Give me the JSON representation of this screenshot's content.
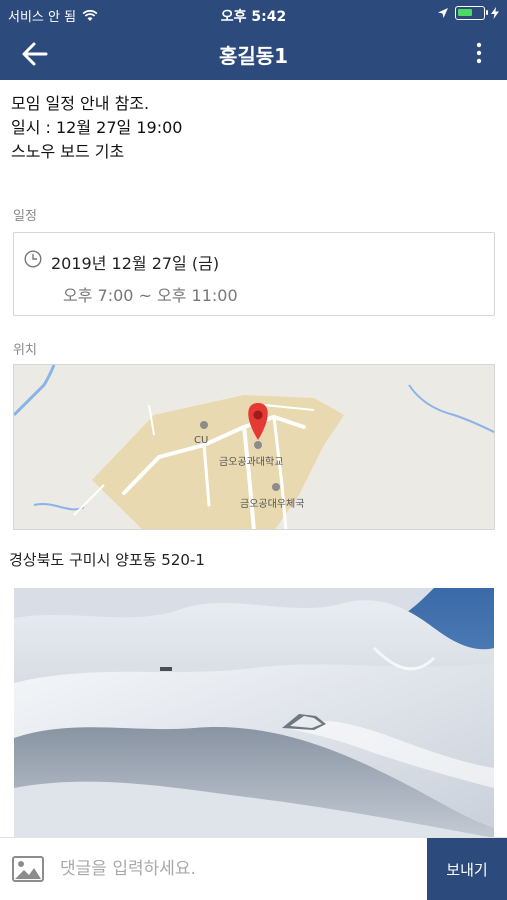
{
  "status_bar": {
    "carrier": "서비스 안 됨",
    "time": "오후 5:42",
    "battery_level": 0.6
  },
  "header": {
    "title": "홍길동1",
    "back_icon": "arrow-left-icon",
    "more_icon": "more-vertical-icon"
  },
  "post": {
    "lines": [
      "모임 일정 안내 참조.",
      "일시 : 12월 27일 19:00",
      "스노우 보드 기초"
    ]
  },
  "schedule": {
    "label": "일정",
    "date": "2019년 12월 27일 (금)",
    "time_range": "오후 7:00 ~ 오후 11:00"
  },
  "location": {
    "label": "위치",
    "map_labels": {
      "store": "CU",
      "university": "금오공과대학교",
      "post_office": "금오공대우체국"
    },
    "address": "경상북도 구미시 양포동 520-1"
  },
  "comment_bar": {
    "placeholder": "댓글을 입력하세요.",
    "send_label": "보내기"
  },
  "colors": {
    "primary": "#2c4a7c",
    "map_pin": "#e53935",
    "campus": "#e8d9b0"
  }
}
